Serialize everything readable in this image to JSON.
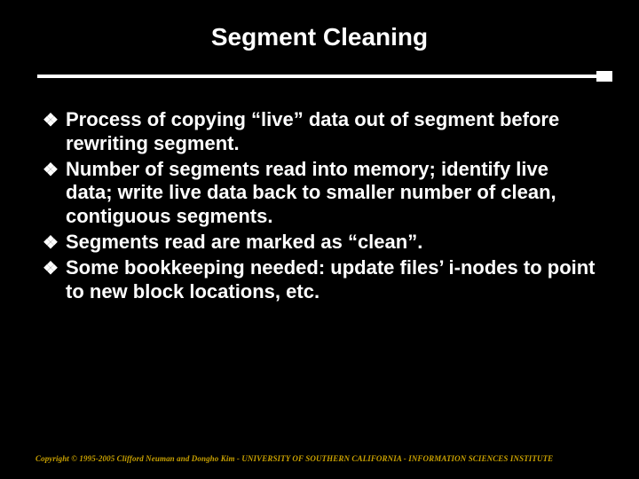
{
  "slide": {
    "title": "Segment Cleaning",
    "bullets": [
      "Process of copying “live” data out of segment before rewriting segment.",
      "Number of segments read into memory; identify live data; write live data back to smaller number of clean, contiguous segments.",
      "Segments read are marked as “clean”.",
      "Some bookkeeping needed: update files’ i-nodes to point to new block locations, etc."
    ],
    "bullet_marker": "❖",
    "footer": "Copyright © 1995-2005 Clifford Neuman and Dongho Kim - UNIVERSITY OF SOUTHERN CALIFORNIA - INFORMATION SCIENCES INSTITUTE"
  }
}
